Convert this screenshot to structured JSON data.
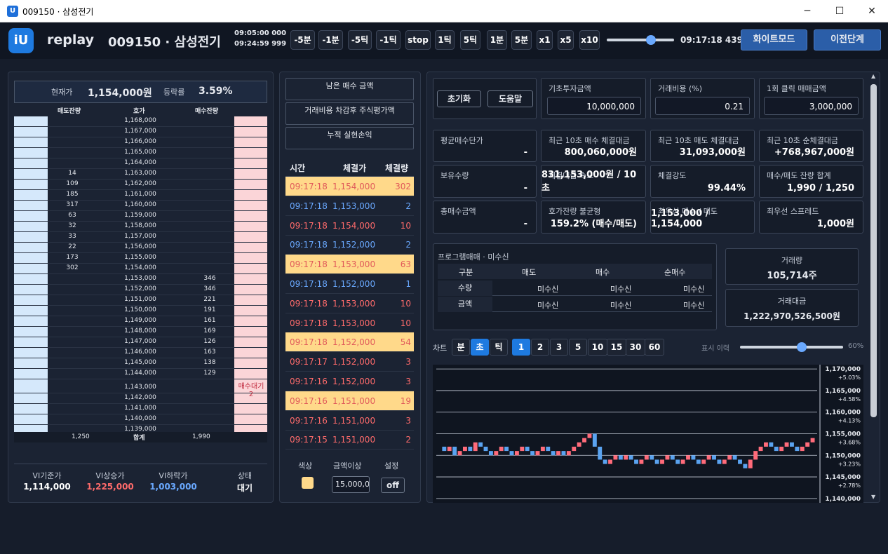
{
  "window": {
    "title": "009150 · 삼성전기",
    "min": "─",
    "max": "☐",
    "close": "✕"
  },
  "app": {
    "logo": "iU",
    "name": "replay",
    "stock": "009150 · 삼성전기",
    "time_start": "09:05:00 000",
    "time_end": "09:24:59 999",
    "current_time": "09:17:18 439",
    "slider_value": 0.66,
    "white_mode": "화이트모드",
    "prev_step": "이전단계"
  },
  "controls": [
    "-5분",
    "-1분",
    "-5틱",
    "-1틱",
    "stop",
    "1틱",
    "5틱",
    "1분",
    "5분",
    "x1",
    "x5",
    "x10"
  ],
  "orderbook": {
    "price_label": "현재가",
    "price": "1,154,000원",
    "change_label": "등락률",
    "change": "3.59%",
    "headers": [
      "매도잔량",
      "호가",
      "매수잔량"
    ],
    "rows": [
      {
        "ask": "",
        "price": "1,168,000",
        "bid": ""
      },
      {
        "ask": "",
        "price": "1,167,000",
        "bid": ""
      },
      {
        "ask": "",
        "price": "1,166,000",
        "bid": ""
      },
      {
        "ask": "",
        "price": "1,165,000",
        "bid": ""
      },
      {
        "ask": "",
        "price": "1,164,000",
        "bid": ""
      },
      {
        "ask": "14",
        "price": "1,163,000",
        "bid": ""
      },
      {
        "ask": "109",
        "price": "1,162,000",
        "bid": ""
      },
      {
        "ask": "185",
        "price": "1,161,000",
        "bid": ""
      },
      {
        "ask": "317",
        "price": "1,160,000",
        "bid": ""
      },
      {
        "ask": "63",
        "price": "1,159,000",
        "bid": ""
      },
      {
        "ask": "32",
        "price": "1,158,000",
        "bid": ""
      },
      {
        "ask": "33",
        "price": "1,157,000",
        "bid": ""
      },
      {
        "ask": "22",
        "price": "1,156,000",
        "bid": ""
      },
      {
        "ask": "173",
        "price": "1,155,000",
        "bid": ""
      },
      {
        "ask": "302",
        "price": "1,154,000",
        "bid": ""
      },
      {
        "ask": "",
        "price": "1,153,000",
        "bid": "346"
      },
      {
        "ask": "",
        "price": "1,152,000",
        "bid": "346"
      },
      {
        "ask": "",
        "price": "1,151,000",
        "bid": "221"
      },
      {
        "ask": "",
        "price": "1,150,000",
        "bid": "191"
      },
      {
        "ask": "",
        "price": "1,149,000",
        "bid": "161"
      },
      {
        "ask": "",
        "price": "1,148,000",
        "bid": "169"
      },
      {
        "ask": "",
        "price": "1,147,000",
        "bid": "126"
      },
      {
        "ask": "",
        "price": "1,146,000",
        "bid": "163"
      },
      {
        "ask": "",
        "price": "1,145,000",
        "bid": "138"
      },
      {
        "ask": "",
        "price": "1,144,000",
        "bid": "129"
      },
      {
        "ask": "",
        "price": "1,143,000",
        "bid": ""
      },
      {
        "ask": "",
        "price": "1,142,000",
        "bid": ""
      },
      {
        "ask": "",
        "price": "1,141,000",
        "bid": ""
      },
      {
        "ask": "",
        "price": "1,140,000",
        "bid": ""
      },
      {
        "ask": "",
        "price": "1,139,000",
        "bid": ""
      }
    ],
    "wait_label": "매수대기",
    "wait_count": "2",
    "total_ask": "1,250",
    "total_label": "합계",
    "total_bid": "1,990",
    "vi": [
      {
        "label": "VI기준가",
        "value": "1,114,000"
      },
      {
        "label": "VI상승가",
        "value": "1,225,000"
      },
      {
        "label": "VI하락가",
        "value": "1,003,000"
      },
      {
        "label": "상태",
        "value": "대기"
      }
    ]
  },
  "trades": {
    "box1": "남은 매수 금액",
    "box2": "거래비용 차감후 주식평가액",
    "box3": "누적 실현손익",
    "headers": [
      "시간",
      "체결가",
      "체결량"
    ],
    "rows": [
      {
        "time": "09:17:18",
        "price": "1,154,000",
        "qty": "302",
        "side": "buy",
        "hl": true
      },
      {
        "time": "09:17:18",
        "price": "1,153,000",
        "qty": "2",
        "side": "sell",
        "hl": false
      },
      {
        "time": "09:17:18",
        "price": "1,154,000",
        "qty": "10",
        "side": "buy",
        "hl": false
      },
      {
        "time": "09:17:18",
        "price": "1,152,000",
        "qty": "2",
        "side": "sell",
        "hl": false
      },
      {
        "time": "09:17:18",
        "price": "1,153,000",
        "qty": "63",
        "side": "buy",
        "hl": true
      },
      {
        "time": "09:17:18",
        "price": "1,152,000",
        "qty": "1",
        "side": "sell",
        "hl": false
      },
      {
        "time": "09:17:18",
        "price": "1,153,000",
        "qty": "10",
        "side": "buy",
        "hl": false
      },
      {
        "time": "09:17:18",
        "price": "1,153,000",
        "qty": "10",
        "side": "buy",
        "hl": false
      },
      {
        "time": "09:17:18",
        "price": "1,152,000",
        "qty": "54",
        "side": "buy",
        "hl": true
      },
      {
        "time": "09:17:17",
        "price": "1,152,000",
        "qty": "3",
        "side": "buy",
        "hl": false
      },
      {
        "time": "09:17:16",
        "price": "1,152,000",
        "qty": "3",
        "side": "buy",
        "hl": false
      },
      {
        "time": "09:17:16",
        "price": "1,151,000",
        "qty": "19",
        "side": "buy",
        "hl": true
      },
      {
        "time": "09:17:16",
        "price": "1,151,000",
        "qty": "3",
        "side": "buy",
        "hl": false
      },
      {
        "time": "09:17:15",
        "price": "1,151,000",
        "qty": "2",
        "side": "buy",
        "hl": false
      }
    ],
    "filter_headers": [
      "색상",
      "금액이상",
      "설정"
    ],
    "filter_amount": "15,000,0",
    "filter_toggle": "off"
  },
  "stats": {
    "reset": "초기화",
    "help": "도움말",
    "invest_label": "기초투자금액",
    "invest": "10,000,000",
    "cost_label": "거래비용 (%)",
    "cost": "0.21",
    "click_label": "1회 클릭 매매금액",
    "click": "3,000,000",
    "cards": [
      {
        "label": "평균매수단가",
        "value": "-"
      },
      {
        "label": "최근 10초 매수 체결대금",
        "value": "800,060,000원"
      },
      {
        "label": "최근 10초 매도 체결대금",
        "value": "31,093,000원"
      },
      {
        "label": "최근 10초 순체결대금",
        "value": "+768,967,000원"
      },
      {
        "label": "보유수량",
        "value": "-"
      },
      {
        "label": "체결대금 속도",
        "value": "831,153,000원 / 10초"
      },
      {
        "label": "체결강도",
        "value": "99.44%"
      },
      {
        "label": "매수/매도 잔량 합계",
        "value": "1,990 / 1,250"
      },
      {
        "label": "총매수금액",
        "value": "-"
      },
      {
        "label": "호가잔량 불균형",
        "value": "159.2% (매수/매도)"
      },
      {
        "label": "최우선 매수 / 매도",
        "value": "1,153,000 / 1,154,000"
      },
      {
        "label": "최우선 스프레드",
        "value": "1,000원"
      }
    ],
    "program": {
      "title": "프로그램매매 · 미수신",
      "headers": [
        "구분",
        "매도",
        "매수",
        "순매수"
      ],
      "rows": [
        {
          "k": "수량",
          "a": "미수신",
          "b": "미수신",
          "c": "미수신"
        },
        {
          "k": "금액",
          "a": "미수신",
          "b": "미수신",
          "c": "미수신"
        }
      ]
    },
    "volume_label": "거래량",
    "volume": "105,714주",
    "amount_label": "거래대금",
    "amount": "1,222,970,526,500원"
  },
  "chart_controls": {
    "label": "차트",
    "units": [
      "분",
      "초",
      "틱"
    ],
    "active_unit": "초",
    "intervals": [
      "1",
      "2",
      "3",
      "5",
      "10",
      "15",
      "30",
      "60"
    ],
    "active_interval": "1",
    "display_label": "표시 이력",
    "display_pct": "60%",
    "display_value": 0.6
  },
  "chart_data": {
    "type": "candlestick",
    "y_ticks": [
      {
        "price": "1,170,000",
        "pct": "+5.03%"
      },
      {
        "price": "1,165,000",
        "pct": "+4.58%"
      },
      {
        "price": "1,160,000",
        "pct": "+4.13%"
      },
      {
        "price": "1,155,000",
        "pct": "+3.68%"
      },
      {
        "price": "1,150,000",
        "pct": "+3.23%"
      },
      {
        "price": "1,145,000",
        "pct": "+2.78%"
      },
      {
        "price": "1,140,000",
        "pct": ""
      }
    ],
    "ylim": [
      1139000,
      1171000
    ],
    "series": [
      1152,
      1151,
      1152,
      1150,
      1151,
      1152,
      1151,
      1153,
      1152,
      1151,
      1150,
      1151,
      1152,
      1151,
      1150,
      1151,
      1152,
      1151,
      1150,
      1151,
      1152,
      1151,
      1150,
      1151,
      1150,
      1151,
      1152,
      1153,
      1154,
      1155,
      1152,
      1149,
      1148,
      1149,
      1150,
      1149,
      1150,
      1149,
      1148,
      1149,
      1150,
      1149,
      1148,
      1149,
      1150,
      1149,
      1148,
      1149,
      1150,
      1149,
      1148,
      1149,
      1150,
      1149,
      1148,
      1149,
      1150,
      1149,
      1148,
      1147,
      1149,
      1151,
      1152,
      1153,
      1152,
      1151,
      1152,
      1153,
      1152,
      1151,
      1152,
      1153,
      1154
    ]
  }
}
